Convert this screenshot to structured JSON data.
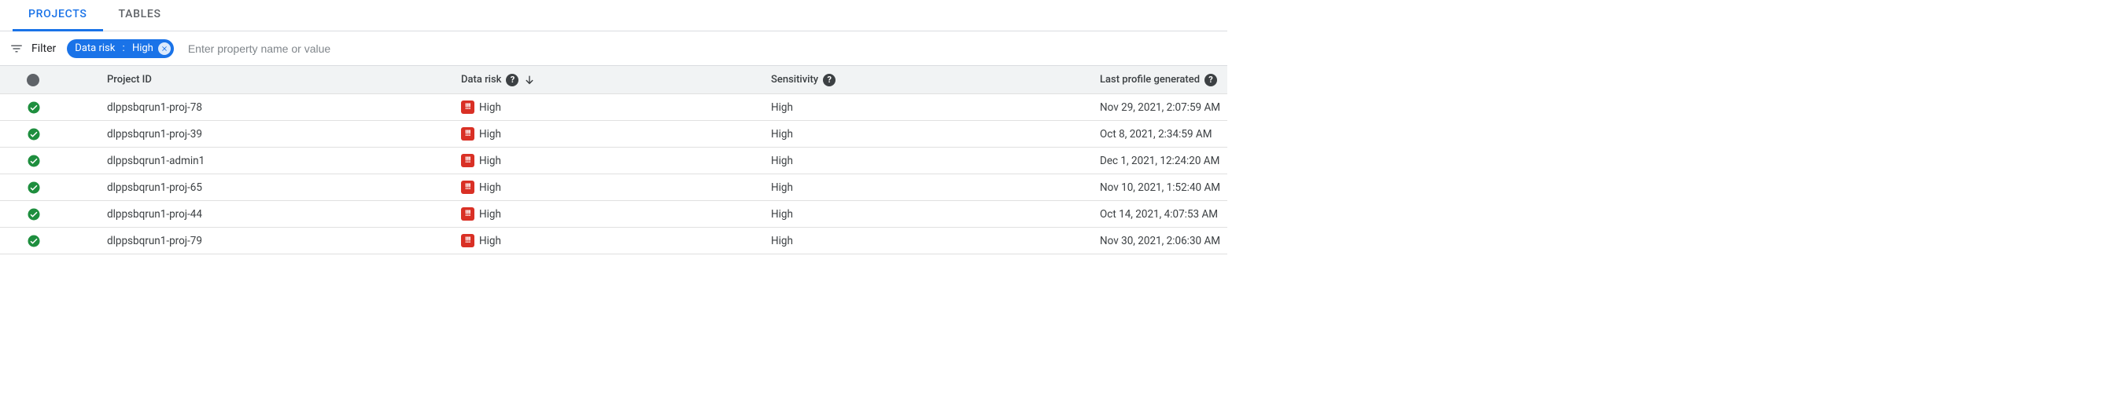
{
  "tabs": {
    "projects": "PROJECTS",
    "tables": "TABLES"
  },
  "filter": {
    "label": "Filter",
    "chip_key": "Data risk",
    "chip_value": "High",
    "placeholder": "Enter property name or value"
  },
  "columns": {
    "project_id": "Project ID",
    "data_risk": "Data risk",
    "sensitivity": "Sensitivity",
    "last_profile": "Last profile generated"
  },
  "rows": [
    {
      "project": "dlppsbqrun1-proj-78",
      "risk": "High",
      "sens": "High",
      "gen": "Nov 29, 2021, 2:07:59 AM"
    },
    {
      "project": "dlppsbqrun1-proj-39",
      "risk": "High",
      "sens": "High",
      "gen": "Oct 8, 2021, 2:34:59 AM"
    },
    {
      "project": "dlppsbqrun1-admin1",
      "risk": "High",
      "sens": "High",
      "gen": "Dec 1, 2021, 12:24:20 AM"
    },
    {
      "project": "dlppsbqrun1-proj-65",
      "risk": "High",
      "sens": "High",
      "gen": "Nov 10, 2021, 1:52:40 AM"
    },
    {
      "project": "dlppsbqrun1-proj-44",
      "risk": "High",
      "sens": "High",
      "gen": "Oct 14, 2021, 4:07:53 AM"
    },
    {
      "project": "dlppsbqrun1-proj-79",
      "risk": "High",
      "sens": "High",
      "gen": "Nov 30, 2021, 2:06:30 AM"
    }
  ]
}
